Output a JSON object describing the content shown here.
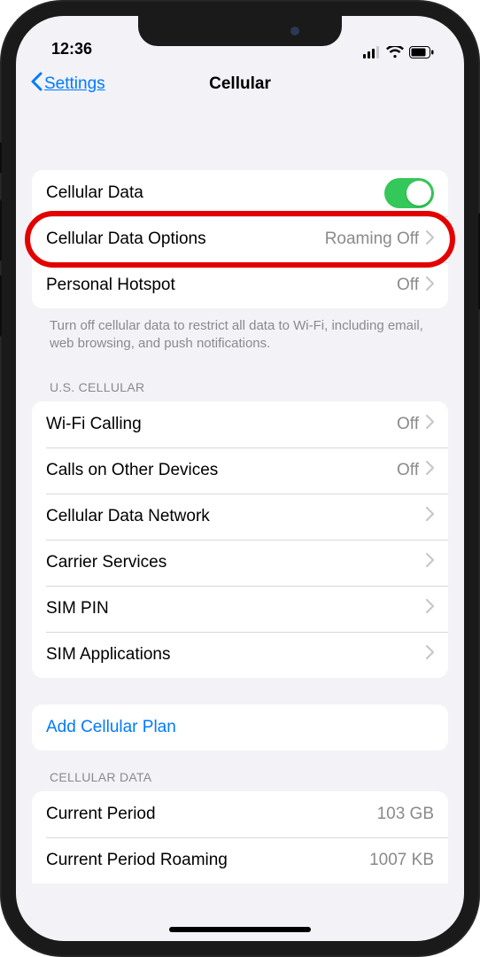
{
  "status": {
    "time": "12:36"
  },
  "nav": {
    "back": "Settings",
    "title": "Cellular"
  },
  "group1": {
    "cellular_data": "Cellular Data",
    "options_label": "Cellular Data Options",
    "options_value": "Roaming Off",
    "hotspot_label": "Personal Hotspot",
    "hotspot_value": "Off",
    "footer": "Turn off cellular data to restrict all data to Wi-Fi, including email, web browsing, and push notifications."
  },
  "carrier": {
    "header": "U.S. CELLULAR",
    "wifi_calling": "Wi-Fi Calling",
    "wifi_calling_value": "Off",
    "calls_other": "Calls on Other Devices",
    "calls_other_value": "Off",
    "data_network": "Cellular Data Network",
    "carrier_services": "Carrier Services",
    "sim_pin": "SIM PIN",
    "sim_apps": "SIM Applications"
  },
  "add_plan": "Add Cellular Plan",
  "usage": {
    "header": "CELLULAR DATA",
    "current_period": "Current Period",
    "current_period_value": "103 GB",
    "roaming": "Current Period Roaming",
    "roaming_value": "1007 KB"
  }
}
